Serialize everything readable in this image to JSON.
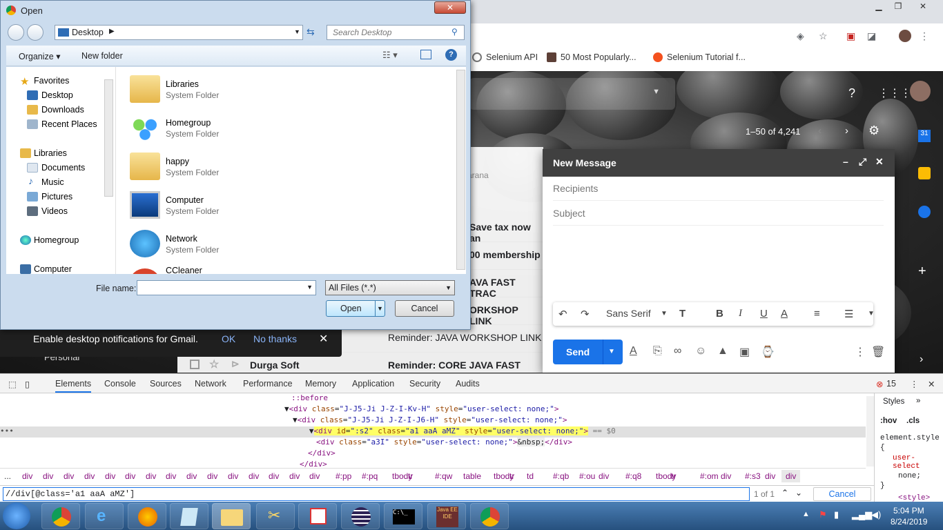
{
  "chrome": {
    "bookmarks": [
      "Selenium API",
      "50 Most Popularly...",
      "Selenium Tutorial f..."
    ]
  },
  "gmail": {
    "page_count": "1–50 of 4,241",
    "sender_snippet": "arana",
    "rows": [
      {
        "sender": "",
        "subject": "Save tax now an"
      },
      {
        "sender": "",
        "subject": "00 membership"
      },
      {
        "sender": "",
        "subject": "AVA FAST TRAC"
      },
      {
        "sender": "",
        "subject": "ORKSHOP LINK"
      }
    ],
    "last_row": {
      "sender": "Durga Soft",
      "subject": "Reminder: CORE JAVA FAST TRAC"
    },
    "reminder_row": "Reminder: JAVA WORKSHOP LINK",
    "personal_label": "Personal",
    "notification": {
      "text": "Enable desktop notifications for Gmail.",
      "ok": "OK",
      "no": "No thanks"
    },
    "compose": {
      "title": "New Message",
      "recipients": "Recipients",
      "subject": "Subject",
      "font": "Sans Serif",
      "send": "Send"
    }
  },
  "devtools": {
    "tabs": [
      "Elements",
      "Console",
      "Sources",
      "Network",
      "Performance",
      "Memory",
      "Application",
      "Security",
      "Audits"
    ],
    "error_count": "15",
    "dom_lines": [
      {
        "indent": "::before"
      },
      {
        "tag": "div",
        "cls": "J-J5-Ji J-Z-I-Kv-H",
        "style": "user-select: none;"
      },
      {
        "tag": "div",
        "cls": "J-J5-Ji J-Z-I-J6-H",
        "style": "user-select: none;"
      },
      {
        "tag": "div",
        "id": ":s2",
        "cls": "a1 aaA aMZ",
        "style": "user-select: none;",
        "suffix": "== $0"
      },
      {
        "tag": "div",
        "cls": "a3I",
        "style": "user-select: none;",
        "inner": "&nbsp;"
      },
      {
        "close": "</div>"
      },
      {
        "close": "</div>"
      }
    ],
    "crumbs": [
      "...",
      "div",
      "div",
      "div",
      "div",
      "div",
      "div",
      "div",
      "div",
      "div",
      "div",
      "div",
      "div",
      "div",
      "div",
      "div",
      "#:pp",
      "#:pq",
      "tbody",
      "tr",
      "#:qw",
      "table",
      "tbody",
      "tr",
      "td",
      "#:qb",
      "#:ou",
      "div",
      "#:q8",
      "tbody",
      "tr",
      "#:om",
      "div",
      "#:s3",
      "div",
      "div",
      "div#:s2.a1.aaA.aMZ"
    ],
    "search_value": "//div[@class='a1 aaA aMZ']",
    "match_count": "1 of 1",
    "cancel": "Cancel",
    "styles": {
      "tab": "Styles",
      "hov": ":hov",
      ".cls": ".cls",
      "rule": "element.style {",
      "prop": "user-select",
      "val": "none;",
      "close": "}",
      "style_tag": "<style>"
    }
  },
  "dialog": {
    "title": "Open",
    "address": "Desktop",
    "search_placeholder": "Search Desktop",
    "organize": "Organize",
    "new_folder": "New folder",
    "nav": [
      {
        "label": "Favorites"
      },
      {
        "label": "Desktop"
      },
      {
        "label": "Downloads"
      },
      {
        "label": "Recent Places"
      },
      {
        "label": "Libraries"
      },
      {
        "label": "Documents"
      },
      {
        "label": "Music"
      },
      {
        "label": "Pictures"
      },
      {
        "label": "Videos"
      },
      {
        "label": "Homegroup"
      },
      {
        "label": "Computer"
      }
    ],
    "files": [
      {
        "name": "Libraries",
        "type": "System Folder"
      },
      {
        "name": "Homegroup",
        "type": "System Folder"
      },
      {
        "name": "happy",
        "type": "System Folder"
      },
      {
        "name": "Computer",
        "type": "System Folder"
      },
      {
        "name": "Network",
        "type": "System Folder"
      },
      {
        "name": "CCleaner",
        "type": ""
      }
    ],
    "file_name_label": "File name:",
    "file_filter": "All Files (*.*)",
    "open": "Open",
    "cancel": "Cancel"
  },
  "taskbar": {
    "time": "5:04 PM",
    "date": "8/24/2019",
    "apps": [
      "Chrome",
      "Internet Explorer",
      "Firefox",
      "Notepad",
      "Explorer",
      "Tools",
      "Paint",
      "Eclipse",
      "Command Prompt",
      "Java EE IDE",
      "Chrome"
    ]
  }
}
